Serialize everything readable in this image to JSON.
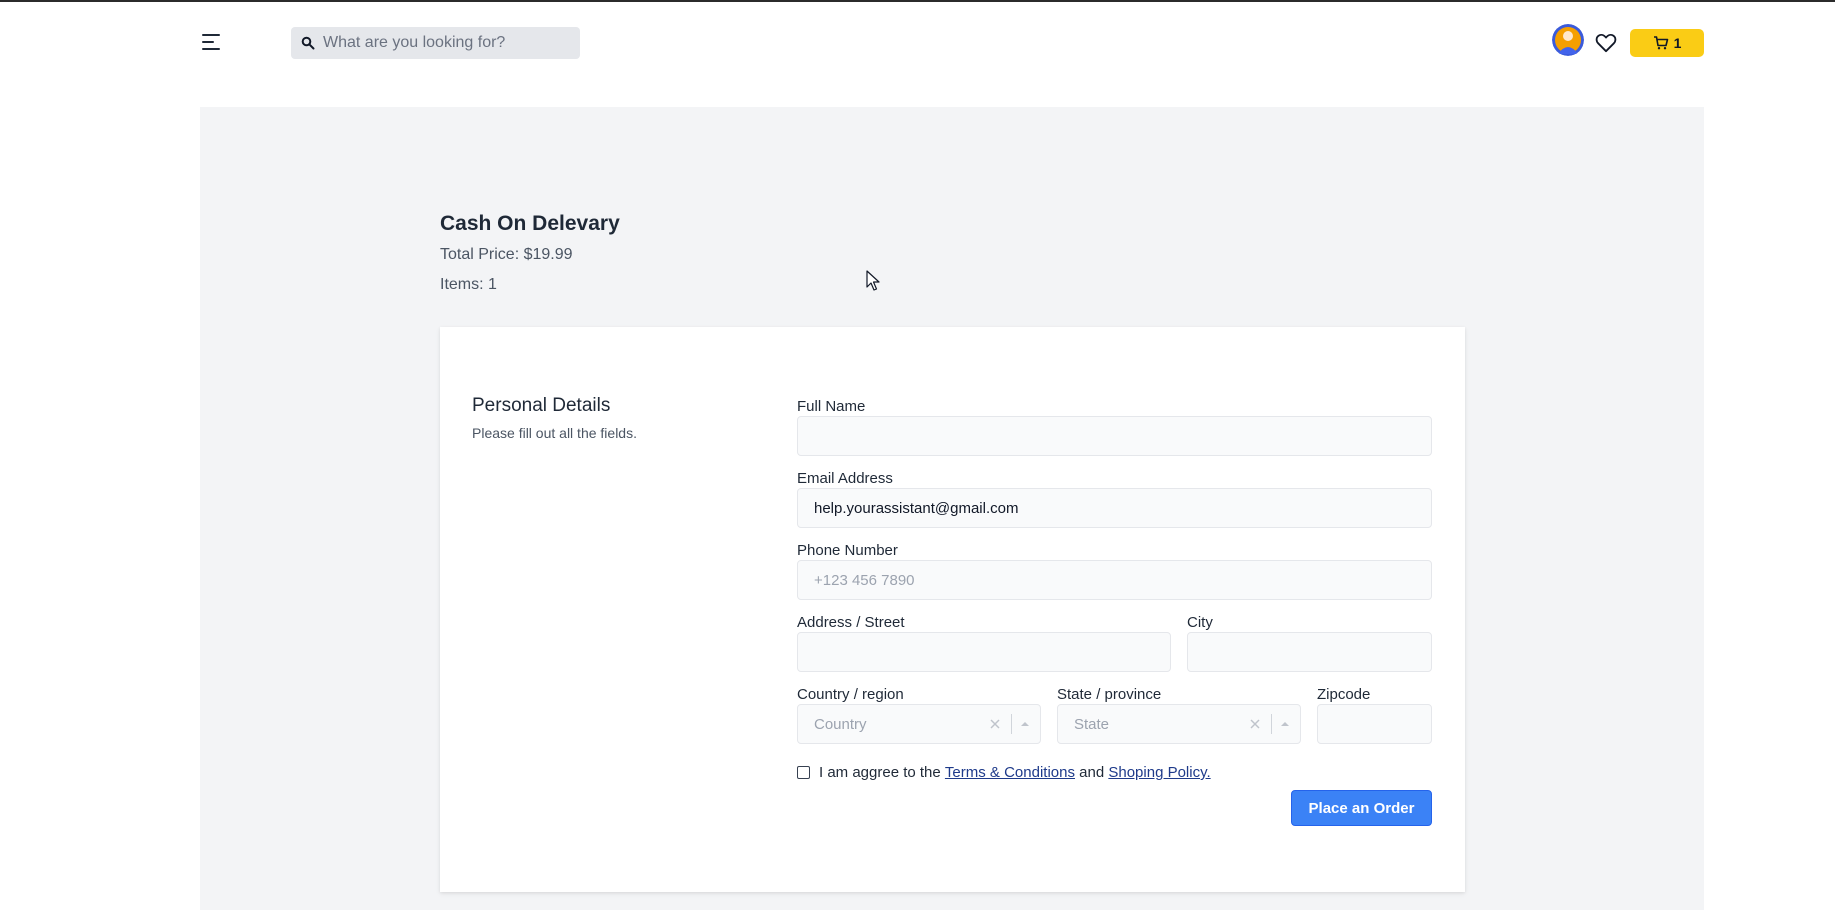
{
  "header": {
    "search_placeholder": "What are you looking for?",
    "cart_count": "1",
    "icons": [
      "menu-icon",
      "search-icon",
      "avatar",
      "heart-icon",
      "cart-icon"
    ],
    "accent_color": "#facc15"
  },
  "summary": {
    "title": "Cash On Delevary",
    "total_price": "Total Price: $19.99",
    "items": "Items: 1"
  },
  "form": {
    "section_title": "Personal Details",
    "section_subtitle": "Please fill out all the fields.",
    "full_name": {
      "label": "Full Name",
      "value": "",
      "placeholder": ""
    },
    "email": {
      "label": "Email Address",
      "value": "help.yourassistant@gmail.com"
    },
    "phone": {
      "label": "Phone Number",
      "value": "",
      "placeholder": "+123 456 7890"
    },
    "address": {
      "label": "Address / Street",
      "value": ""
    },
    "city": {
      "label": "City",
      "value": ""
    },
    "country": {
      "label": "Country / region",
      "placeholder": "Country"
    },
    "state": {
      "label": "State / province",
      "placeholder": "State"
    },
    "zipcode": {
      "label": "Zipcode",
      "value": ""
    },
    "agree": {
      "prefix": "I am aggree to the ",
      "terms_link": "Terms & Conditions",
      "middle": " and ",
      "policy_link": "Shoping Policy.",
      "checked": false
    },
    "submit_label": "Place an Order",
    "submit_color": "#3b82f6"
  }
}
